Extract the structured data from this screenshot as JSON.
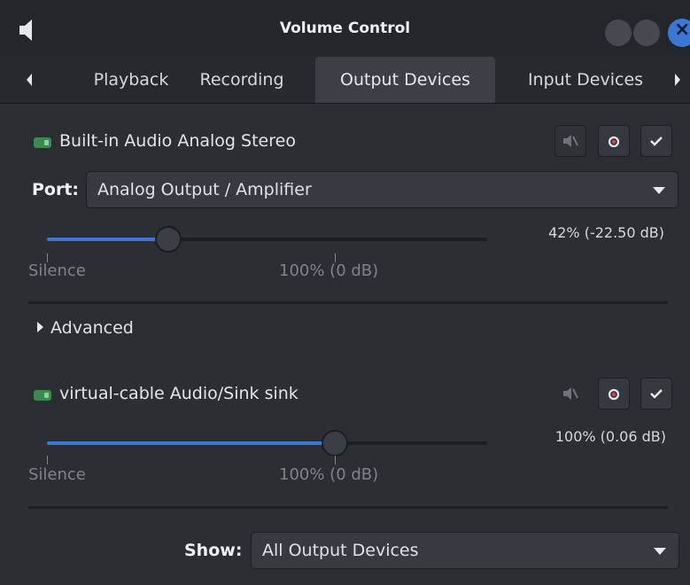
{
  "window": {
    "title": "Volume Control"
  },
  "tabs": [
    {
      "label": "Playback"
    },
    {
      "label": "Recording"
    },
    {
      "label": "Output Devices"
    },
    {
      "label": "Input Devices"
    }
  ],
  "devices": [
    {
      "name": "Built-in Audio Analog Stereo",
      "port_label": "Port:",
      "port_value": "Analog Output / Amplifier",
      "volume_text": "42% (-22.50 dB)",
      "volume_fraction": 0.42,
      "marks": {
        "silence": "Silence",
        "full": "100% (0 dB)"
      }
    },
    {
      "name": "virtual-cable Audio/Sink sink",
      "volume_text": "100% (0.06 dB)",
      "volume_fraction": 1.0,
      "marks": {
        "silence": "Silence",
        "full": "100% (0 dB)"
      }
    }
  ],
  "advanced_label": "Advanced",
  "show": {
    "label": "Show:",
    "value": "All Output Devices"
  },
  "colors": {
    "accent": "#3d77d6",
    "background": "#2b2e33"
  },
  "icons": {
    "title": "speaker-icon",
    "device": "sound-card-icon",
    "mute": "mute-icon",
    "fallback": "record-icon",
    "default": "check-icon"
  }
}
